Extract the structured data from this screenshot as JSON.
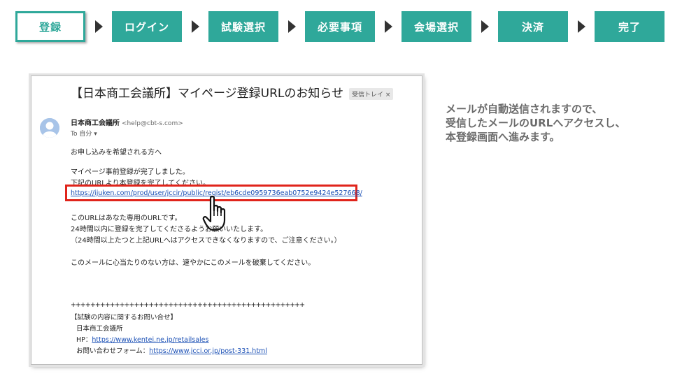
{
  "steps": [
    {
      "label": "登録",
      "active": true
    },
    {
      "label": "ログイン",
      "active": false
    },
    {
      "label": "試験選択",
      "active": false
    },
    {
      "label": "必要事項",
      "active": false
    },
    {
      "label": "会場選択",
      "active": false
    },
    {
      "label": "決済",
      "active": false
    },
    {
      "label": "完了",
      "active": false
    }
  ],
  "colors": {
    "accent": "#2fa89a",
    "highlight": "#e0241b",
    "link": "#1a4fb5"
  },
  "email": {
    "subject": "【日本商工会議所】マイページ登録URLのお知らせ",
    "badge": "受信トレイ ×",
    "sender_name": "日本商工会議所",
    "sender_email": "<help@cbt-s.com>",
    "to": "To 自分 ▾",
    "greeting": "お申し込みを希望される方へ",
    "line1": "マイページ事前登録が完了しました。",
    "line2": "下記のURLより本登録を完了してください。",
    "url": "https://ijuken.com/prod/user/jccir/public/regist/eb6cde0959736eab0752e9424e527668/",
    "line3": "このURLはあなた専用のURLです。",
    "line4": "24時間以内に登録を完了してくださるようお願いいたします。",
    "line5": "（24時間以上たつと上記URLへはアクセスできなくなりますので、ご注意ください。）",
    "line6": "このメールに心当たりのない方は、速やかにこのメールを破棄してください。",
    "separator": "++++++++++++++++++++++++++++++++++++++++++++++++",
    "contact_title": "【試験の内容に関するお問い合せ】",
    "org": "日本商工会議所",
    "hp_label": "HP：",
    "hp_url": "https://www.kentei.ne.jp/retailsales",
    "form_label": "お問い合わせフォーム：",
    "form_url": "https://www.jcci.or.jp/post-331.html"
  },
  "explanation": [
    "メールが自動送信されますので、",
    "受信したメールのURLへアクセスし、",
    "本登録画面へ進みます。"
  ]
}
